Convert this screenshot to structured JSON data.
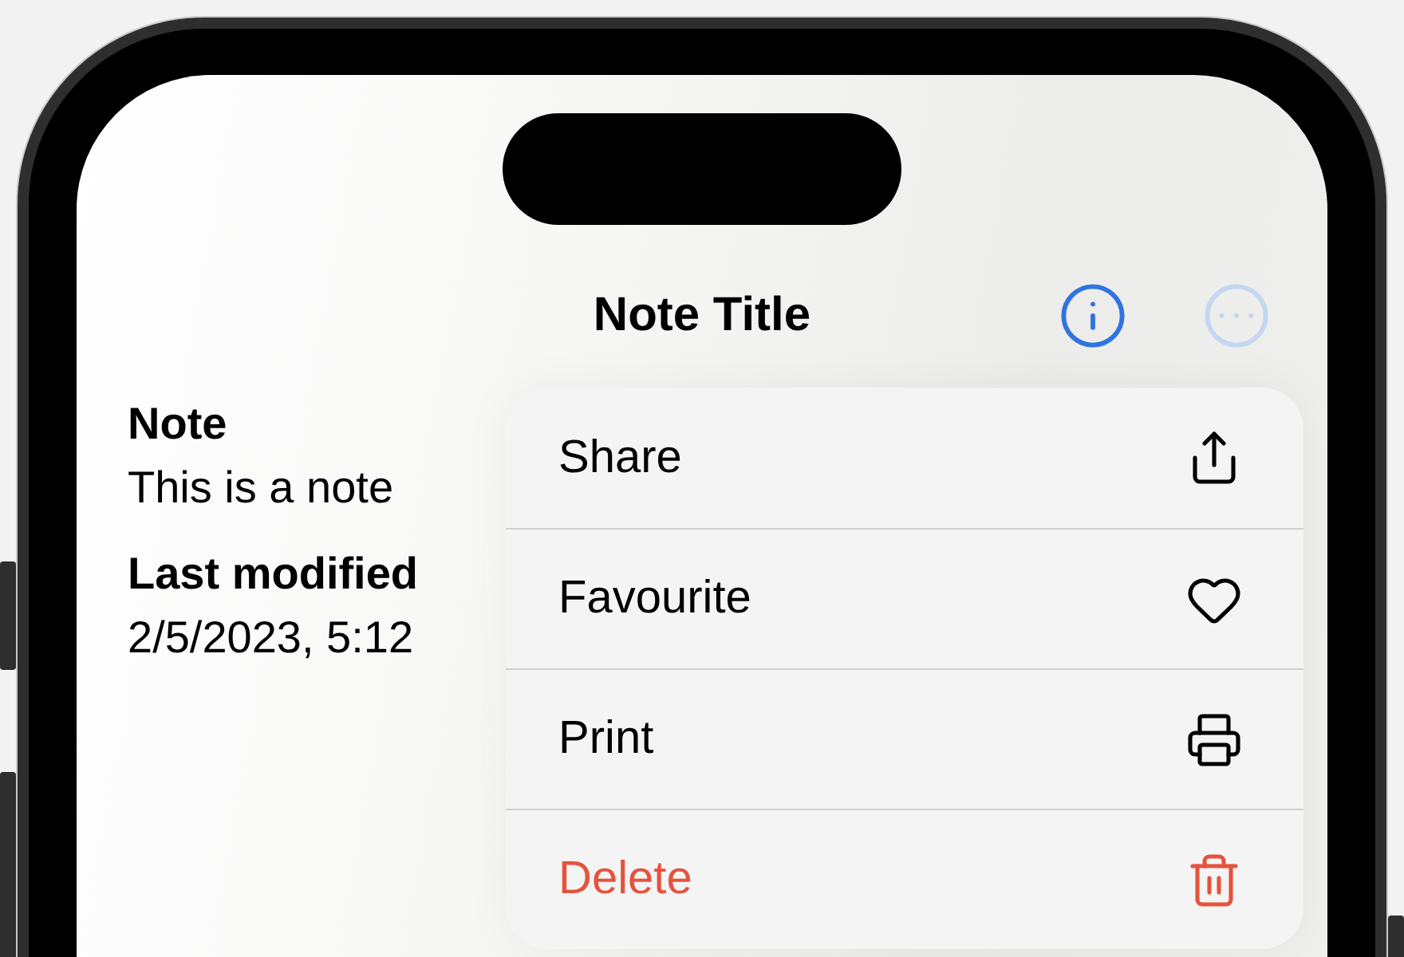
{
  "nav_bar": {
    "title": "Note Title"
  },
  "sections": [
    {
      "heading": "Note",
      "value": "This is a note"
    },
    {
      "heading": "Last modified",
      "value": "2/5/2023, 5:12"
    }
  ],
  "menu": {
    "open": true,
    "items": [
      {
        "label": "Share",
        "kind": "normal"
      },
      {
        "label": "Favourite",
        "kind": "normal"
      },
      {
        "label": "Print",
        "kind": "normal"
      },
      {
        "label": "Delete",
        "kind": "destructive"
      }
    ]
  }
}
